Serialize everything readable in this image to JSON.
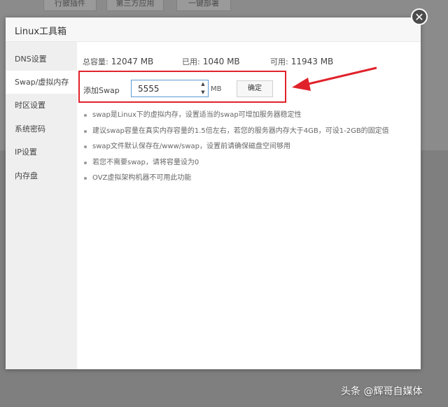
{
  "background": {
    "toolbar_buttons": [
      "行披插件",
      "第三方应用",
      "一键部署"
    ]
  },
  "dialog": {
    "title": "Linux工具箱",
    "close_icon": "close-icon"
  },
  "sidebar": {
    "items": [
      {
        "label": "DNS设置",
        "active": false
      },
      {
        "label": "Swap/虚拟内存",
        "active": true
      },
      {
        "label": "时区设置",
        "active": false
      },
      {
        "label": "系统密码",
        "active": false
      },
      {
        "label": "IP设置",
        "active": false
      },
      {
        "label": "内存盘",
        "active": false
      }
    ]
  },
  "memory": {
    "total_label": "总容量:",
    "total_value": "12047 MB",
    "used_label": "已用:",
    "used_value": "1040 MB",
    "available_label": "可用:",
    "available_value": "11943 MB"
  },
  "swap": {
    "label": "添加Swap",
    "value": "5555",
    "unit": "MB",
    "confirm_label": "确定"
  },
  "tips": [
    "swap是Linux下的虚拟内存，设置适当的swap可增加服务器稳定性",
    "建议swap容量在真实内存容量的1.5倍左右，若您的服务器内存大于4GB，可设1-2GB的固定值",
    "swap文件默认保存在/www/swap，设置前请确保磁盘空间够用",
    "若您不需要swap，请将容量设为0",
    "OVZ虚拟架构机器不可用此功能"
  ],
  "annotation": {
    "highlight_color": "#e0232b"
  },
  "footer": {
    "credit": "头条 @辉哥自媒体"
  }
}
